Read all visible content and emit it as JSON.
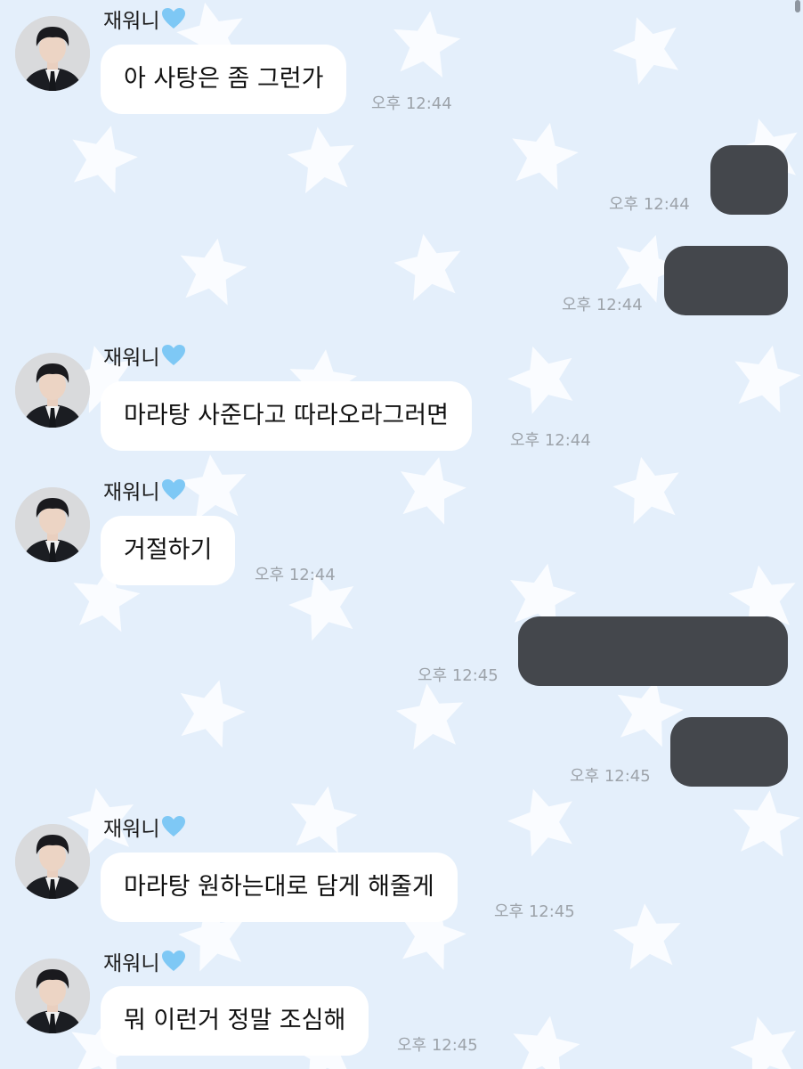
{
  "colors": {
    "background": "#e4effb",
    "incoming_bubble": "#ffffff",
    "outgoing_bubble": "#44474c",
    "timestamp": "#9da3aa",
    "heart": "#7ec8f5"
  },
  "messages": [
    {
      "direction": "incoming",
      "sender": "재워니",
      "sender_icon": "light-blue-heart-icon",
      "text": "아 사탕은 좀 그런가",
      "time": "오후 12:44"
    },
    {
      "direction": "outgoing",
      "text": "",
      "time": "오후 12:44"
    },
    {
      "direction": "outgoing",
      "text": "",
      "time": "오후 12:44"
    },
    {
      "direction": "incoming",
      "sender": "재워니",
      "sender_icon": "light-blue-heart-icon",
      "text": "마라탕 사준다고 따라오라그러면",
      "time": "오후 12:44"
    },
    {
      "direction": "incoming",
      "sender": "재워니",
      "sender_icon": "light-blue-heart-icon",
      "text": "거절하기",
      "time": "오후 12:44"
    },
    {
      "direction": "outgoing",
      "text": "",
      "time": "오후 12:45"
    },
    {
      "direction": "outgoing",
      "text": "",
      "time": "오후 12:45"
    },
    {
      "direction": "incoming",
      "sender": "재워니",
      "sender_icon": "light-blue-heart-icon",
      "text": "마라탕 원하는대로 담게 해줄게",
      "time": "오후 12:45"
    },
    {
      "direction": "incoming",
      "sender": "재워니",
      "sender_icon": "light-blue-heart-icon",
      "text": "뭐 이런거 정말 조심해",
      "time": "오후 12:45"
    }
  ]
}
